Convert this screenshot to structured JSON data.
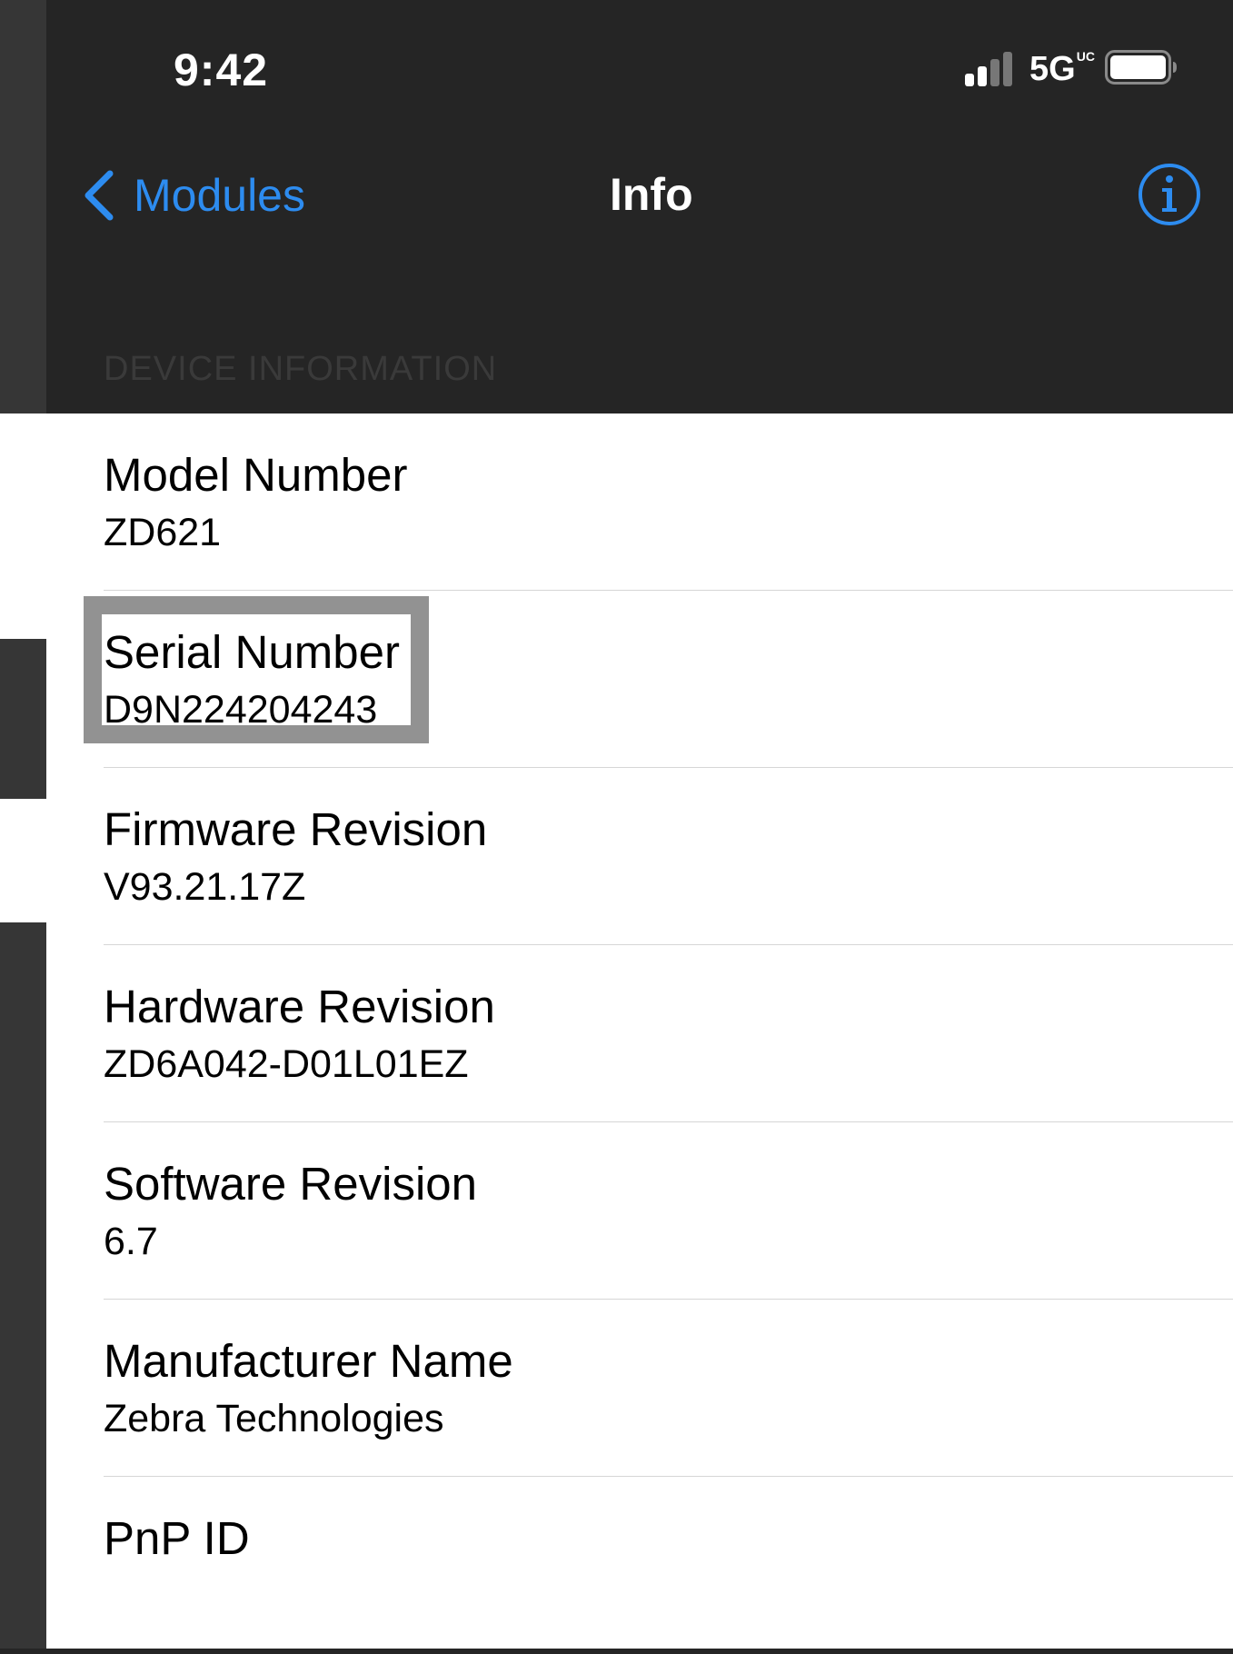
{
  "status_bar": {
    "time": "9:42",
    "network": "5G",
    "network_badge": "UC",
    "signal_bars": 2,
    "signal_bars_total": 4
  },
  "nav": {
    "back_label": "Modules",
    "title": "Info",
    "info_icon": "info-circle-icon",
    "accent_color": "#2d8cf0"
  },
  "section": {
    "header": "DEVICE INFORMATION"
  },
  "rows": [
    {
      "label": "Model Number",
      "value": "ZD621"
    },
    {
      "label": "Serial Number",
      "value": "D9N224204243"
    },
    {
      "label": "Firmware Revision",
      "value": "V93.21.17Z"
    },
    {
      "label": "Hardware Revision",
      "value": "ZD6A042-D01L01EZ"
    },
    {
      "label": "Software Revision",
      "value": "6.7"
    },
    {
      "label": "Manufacturer Name",
      "value": "Zebra Technologies"
    },
    {
      "label": "PnP ID",
      "value": ""
    }
  ]
}
